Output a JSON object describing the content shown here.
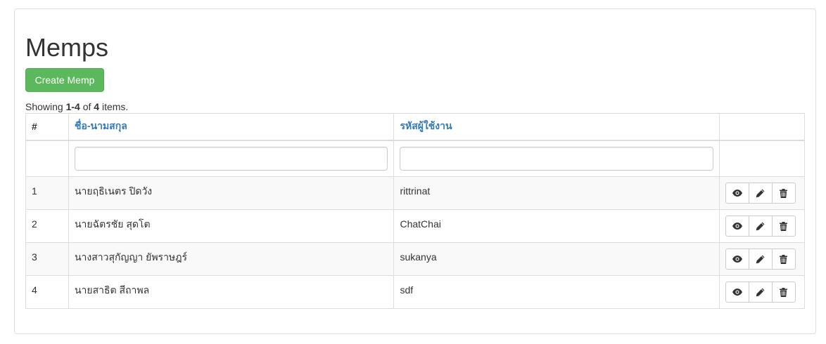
{
  "page": {
    "title": "Memps",
    "create_label": "Create Memp"
  },
  "summary": {
    "prefix": "Showing ",
    "range": "1-4",
    "middle": " of ",
    "total": "4",
    "suffix": " items."
  },
  "table": {
    "columns": [
      "#",
      "ชื่อ-นามสกุล",
      "รหัสผู้ใช้งาน",
      ""
    ],
    "filters": {
      "name": "",
      "username": ""
    },
    "rows": [
      {
        "num": "1",
        "name": "นายฤธิเนตร ปิดวัง",
        "username": "rittrinat"
      },
      {
        "num": "2",
        "name": "นายฉัตรชัย สุดโต",
        "username": "ChatChai"
      },
      {
        "num": "3",
        "name": "นางสาวสุกัญญา ยัพราษฎร์",
        "username": "sukanya"
      },
      {
        "num": "4",
        "name": "นายสาธิต สีถาพล",
        "username": "sdf"
      }
    ],
    "actions": [
      "view-icon",
      "edit-icon",
      "delete-icon"
    ]
  },
  "colors": {
    "primary_success": "#5cb85c",
    "link": "#337ab7",
    "border": "#dddddd",
    "stripe": "#f9f9f9"
  }
}
